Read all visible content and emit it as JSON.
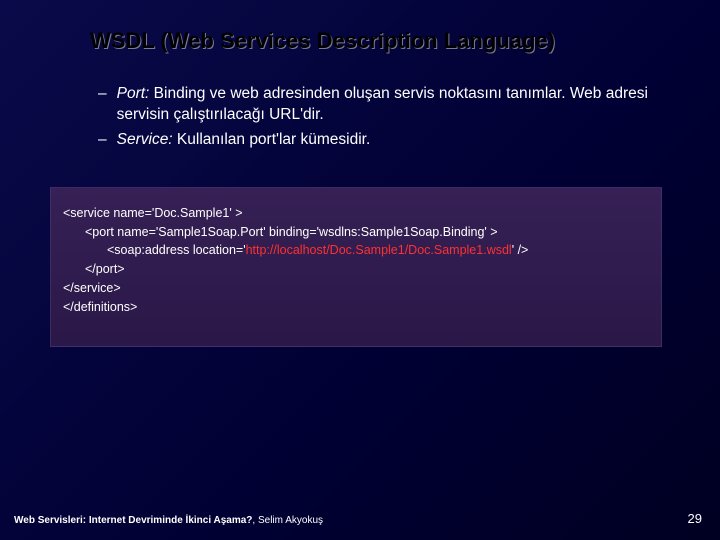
{
  "title": "WSDL (Web Services Description Language)",
  "bullets": [
    {
      "term": "Port:",
      "text": " Binding ve web adresinden oluşan servis noktasını tanımlar. Web adresi servisin çalıştırılacağı URL'dir."
    },
    {
      "term": "Service:",
      "text": " Kullanılan port'lar kümesidir."
    }
  ],
  "code": {
    "l1a": "<service name='Doc.Sample1' >",
    "l2a": "<port name='Sample1Soap.Port' binding='wsdlns:Sample1Soap.Binding' >",
    "l3a": "<soap:address location='",
    "l3addr": "http://localhost/Doc.Sample1/Doc.Sample1.wsdl",
    "l3b": "' />",
    "l4": "</port>",
    "l5": "</service>",
    "l6": "</definitions>"
  },
  "footer": {
    "title": "Web Servisleri: Internet Devriminde İkinci Aşama?",
    "author": ", Selim Akyokuş"
  },
  "pagenum": "29"
}
